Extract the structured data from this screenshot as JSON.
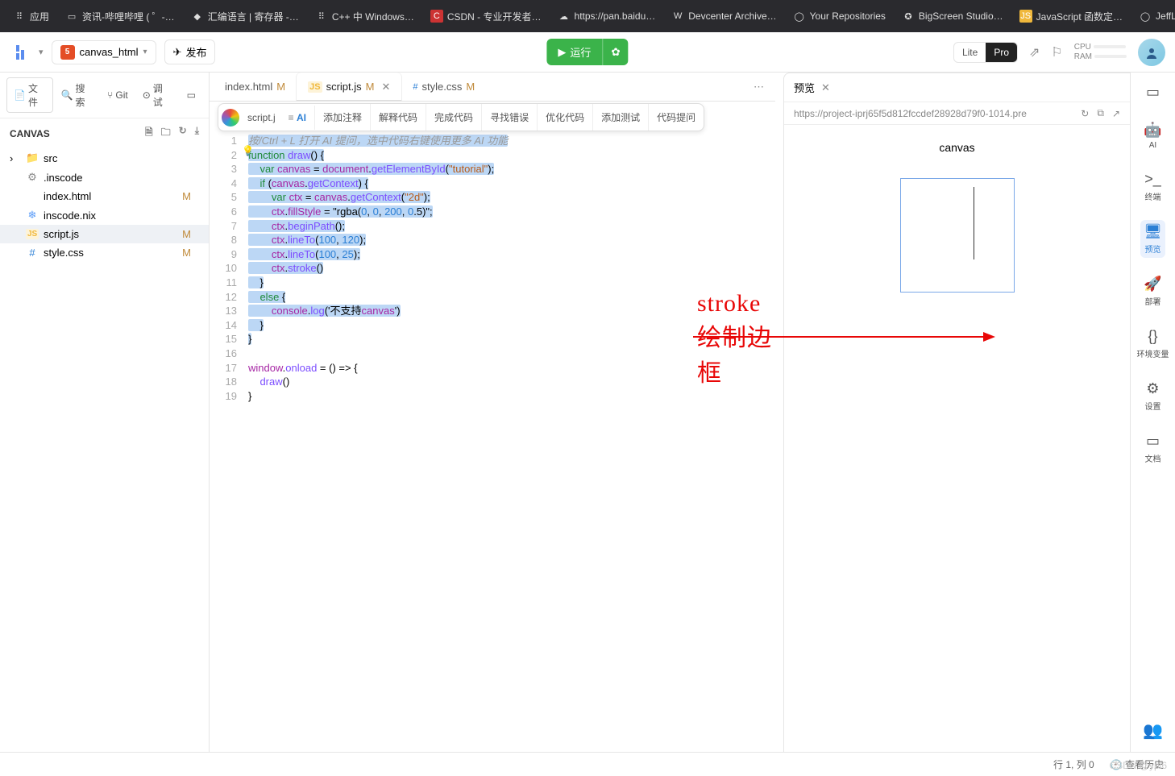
{
  "bookmarks": [
    {
      "icon": "⠿",
      "label": "应用"
    },
    {
      "icon": "▭",
      "label": "资讯-哔哩哔哩 ( ゜-…"
    },
    {
      "icon": "◆",
      "label": "汇编语言 | 寄存器 -…"
    },
    {
      "icon": "⠿",
      "label": "C++ 中 Windows…"
    },
    {
      "icon": "C",
      "label": "CSDN - 专业开发者…",
      "iconbg": "#c33"
    },
    {
      "icon": "☁",
      "label": "https://pan.baidu…"
    },
    {
      "icon": "W",
      "label": "Devcenter Archive…"
    },
    {
      "icon": "◯",
      "label": "Your Repositories"
    },
    {
      "icon": "✪",
      "label": "BigScreen Studio…"
    },
    {
      "icon": "JS",
      "label": "JavaScript 函数定…",
      "iconbg": "#f0b83c"
    },
    {
      "icon": "◯",
      "label": "JeffLi…"
    }
  ],
  "project_name": "canvas_html",
  "publish_label": "发布",
  "run_label": "运行",
  "lite": "Lite",
  "pro": "Pro",
  "cpu": "CPU",
  "ram": "RAM",
  "sidebar": {
    "file": "文件",
    "search": "搜索",
    "git": "Git",
    "debug": "调试",
    "project": "CANVAS",
    "items": [
      {
        "icon": "folder",
        "label": "src",
        "depth": 1,
        "chev": true
      },
      {
        "icon": "conf",
        "label": ".inscode",
        "depth": 1
      },
      {
        "icon": "html",
        "label": "index.html",
        "depth": 1,
        "mod": "M"
      },
      {
        "icon": "nix",
        "label": "inscode.nix",
        "depth": 1
      },
      {
        "icon": "js",
        "label": "script.js",
        "depth": 1,
        "mod": "M",
        "active": true
      },
      {
        "icon": "css",
        "label": "style.css",
        "depth": 1,
        "mod": "M"
      }
    ]
  },
  "tabs": [
    {
      "icon": "html",
      "label": "index.html",
      "mod": "M"
    },
    {
      "icon": "js",
      "label": "script.js",
      "mod": "M",
      "active": true,
      "close": true
    },
    {
      "icon": "css",
      "label": "style.css",
      "mod": "M"
    }
  ],
  "ai_row": {
    "script": "script.j",
    "ai": "AI",
    "items": [
      "添加注释",
      "解释代码",
      "完成代码",
      "寻找错误",
      "优化代码",
      "添加测试",
      "代码提问"
    ]
  },
  "code": {
    "hint": "按/Ctrl + L 打开 AI 提问，选中代码右键使用更多 AI 功能",
    "lines": [
      "",
      "function draw() {",
      "    var canvas = document.getElementById(\"tutorial\");",
      "    if (canvas.getContext) {",
      "        var ctx = canvas.getContext(\"2d\");",
      "        ctx.fillStyle = \"rgba(0, 0, 200, 0.5)\";",
      "        ctx.beginPath();",
      "        ctx.lineTo(100, 120);",
      "        ctx.lineTo(100, 25);",
      "        ctx.stroke()",
      "    }",
      "    else {",
      "        console.log('不支持canvas')",
      "    }",
      "}",
      "",
      "window.onload = () => {",
      "    draw()",
      "}"
    ],
    "selected_fragment": "rgba(0, 0, 200, 0.5)"
  },
  "annotation": "stroke绘制边框",
  "preview": {
    "title": "预览",
    "url": "https://project-iprj65f5d812fccdef28928d79f0-1014.pre",
    "canvas_label": "canvas"
  },
  "rail": [
    {
      "icon": "▭",
      "label": ""
    },
    {
      "icon": "🤖",
      "label": "AI"
    },
    {
      "icon": ">_",
      "label": "终端"
    },
    {
      "icon": "🖥",
      "label": "预览",
      "active": true
    },
    {
      "icon": "🚀",
      "label": "部署"
    },
    {
      "icon": "{}",
      "label": "环境变量"
    },
    {
      "icon": "⚙",
      "label": "设置"
    },
    {
      "icon": "▭",
      "label": "文档"
    }
  ],
  "status": {
    "pos": "行 1, 列 0",
    "history": "查看历史"
  },
  "watermark": "CSDN @ypl6"
}
